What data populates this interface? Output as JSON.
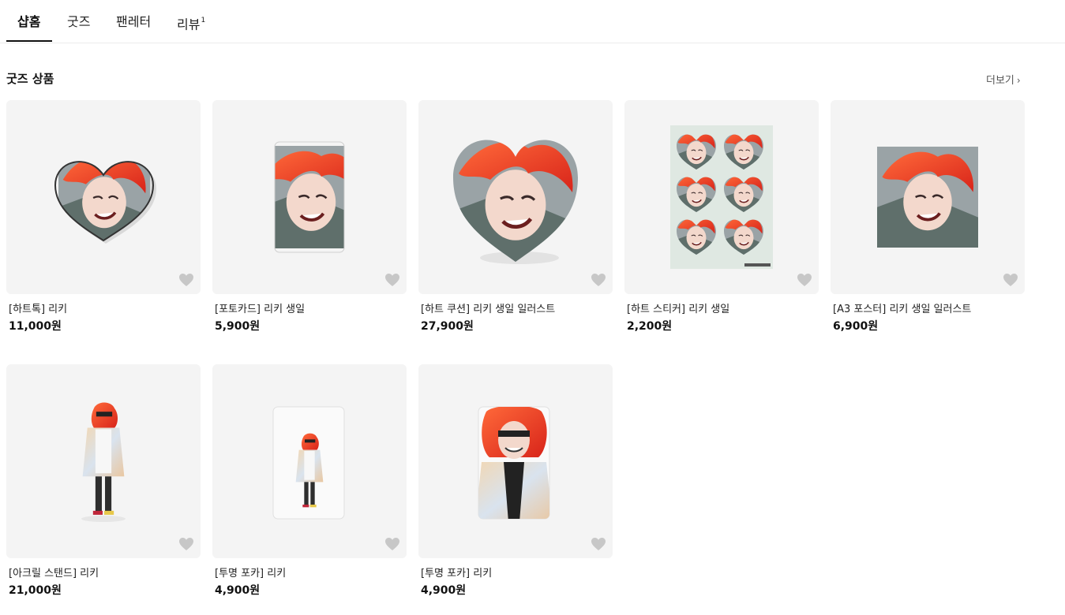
{
  "tabs": [
    {
      "label": "샵홈"
    },
    {
      "label": "굿즈"
    },
    {
      "label": "팬레터"
    },
    {
      "label": "리뷰",
      "count": "1"
    }
  ],
  "section": {
    "title": "굿즈 상품",
    "more_label": "더보기"
  },
  "products": [
    {
      "name": "[하트톡] 리키",
      "price": "11,000원"
    },
    {
      "name": "[포토카드] 리키 생일",
      "price": "5,900원"
    },
    {
      "name": "[하트 쿠션] 리키 생일 일러스트",
      "price": "27,900원"
    },
    {
      "name": "[하트 스티커] 리키 생일",
      "price": "2,200원"
    },
    {
      "name": "[A3 포스터] 리키 생일 일러스트",
      "price": "6,900원"
    },
    {
      "name": "[아크릴 스탠드] 리키",
      "price": "21,000원"
    },
    {
      "name": "[투명 포카] 리키",
      "price": "4,900원"
    },
    {
      "name": "[투명 포카] 리키",
      "price": "4,900원"
    }
  ],
  "colors": {
    "card_bg": "#f4f4f4",
    "heart_icon": "#c7c7c7",
    "hair": "#ee3a24",
    "accent_text": "#111111"
  }
}
